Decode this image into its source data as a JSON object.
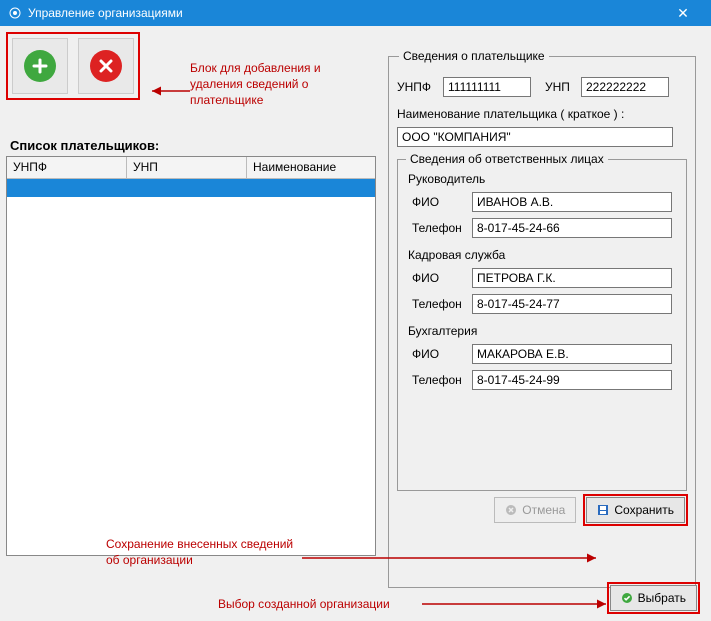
{
  "window": {
    "title": "Управление организациями"
  },
  "annotations": {
    "toolbar": "Блок для добавления и удаления сведений о плательщике",
    "save": "Сохранение внесенных сведений об организации",
    "choose": "Выбор созданной организации"
  },
  "list": {
    "caption": "Список плательщиков:",
    "columns": {
      "c1": "УНПФ",
      "c2": "УНП",
      "c3": "Наименование"
    }
  },
  "payer": {
    "group_title": "Сведения о плательщике",
    "unpf_label": "УНПФ",
    "unpf_value": "111111111",
    "unp_label": "УНП",
    "unp_value": "222222222",
    "name_label": "Наименование плательщика  ( краткое ) :",
    "name_value": "ООО \"КОМПАНИЯ\"",
    "responsibles": {
      "title": "Сведения об ответственных лицах",
      "director": {
        "title": "Руководитель",
        "fio_label": "ФИО",
        "fio_value": "ИВАНОВ А.В.",
        "phone_label": "Телефон",
        "phone_value": "8-017-45-24-66"
      },
      "hr": {
        "title": "Кадровая служба",
        "fio_label": "ФИО",
        "fio_value": "ПЕТРОВА Г.К.",
        "phone_label": "Телефон",
        "phone_value": "8-017-45-24-77"
      },
      "accounting": {
        "title": "Бухгалтерия",
        "fio_label": "ФИО",
        "fio_value": "МАКАРОВА Е.В.",
        "phone_label": "Телефон",
        "phone_value": "8-017-45-24-99"
      }
    },
    "buttons": {
      "cancel": "Отмена",
      "save": "Сохранить",
      "choose": "Выбрать"
    }
  }
}
